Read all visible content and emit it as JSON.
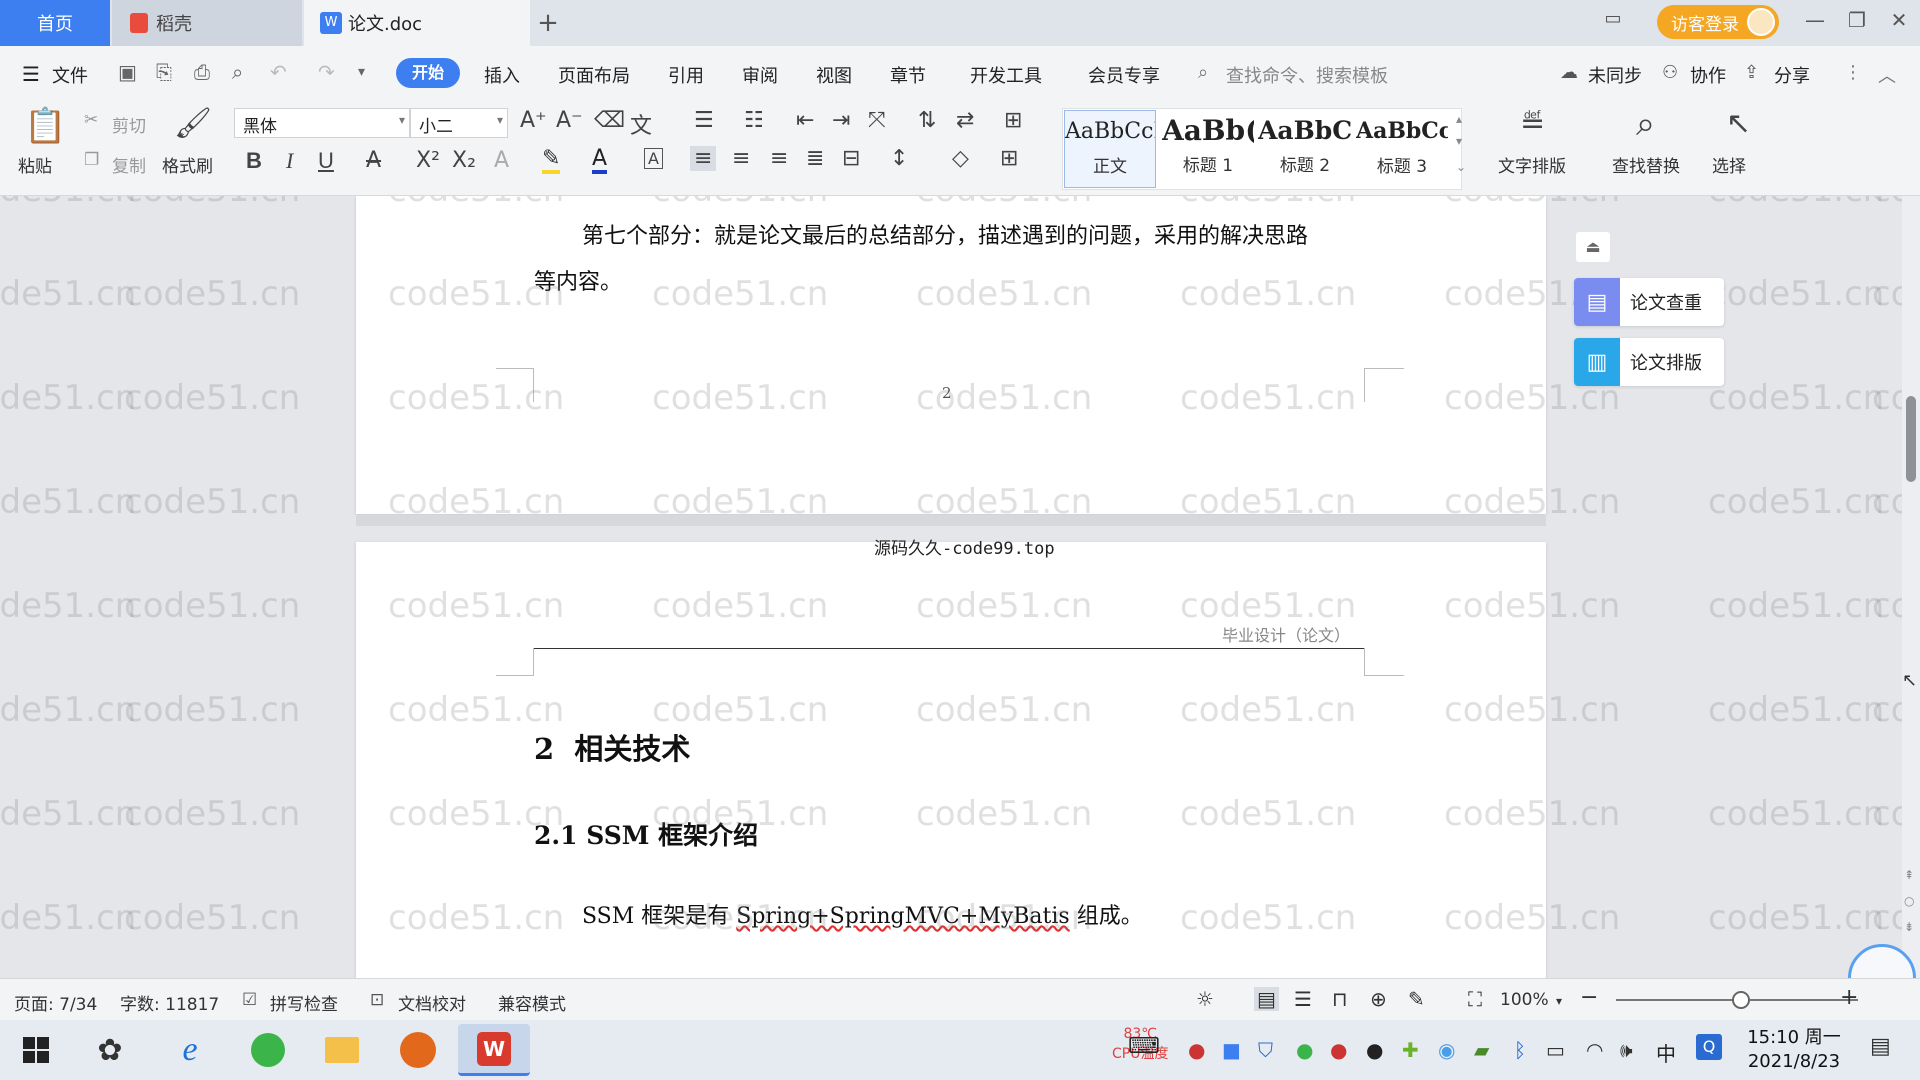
{
  "tabs": {
    "home": "首页",
    "daoke": "稻壳",
    "doc": "论文.doc",
    "add": "+"
  },
  "login": {
    "label": "访客登录"
  },
  "menu": {
    "file": "文件",
    "items": [
      "开始",
      "插入",
      "页面布局",
      "引用",
      "审阅",
      "视图",
      "章节",
      "开发工具",
      "会员专享"
    ],
    "search_placeholder": "查找命令、搜索模板",
    "sync": "未同步",
    "collab": "协作",
    "share": "分享"
  },
  "ribbon": {
    "paste": "粘贴",
    "cut": "剪切",
    "copy": "复制",
    "format_painter": "格式刷",
    "font_name": "黑体",
    "font_size": "小二",
    "bold": "B",
    "italic": "I",
    "underline": "U",
    "styles": [
      {
        "sample": "AaBbCcI",
        "name": "正文"
      },
      {
        "sample": "AaBb(",
        "name": "标题 1"
      },
      {
        "sample": "AaBbC",
        "name": "标题 2"
      },
      {
        "sample": "AaBbCcl",
        "name": "标题 3"
      }
    ],
    "text_layout": "文字排版",
    "find_replace": "查找替换",
    "select": "选择"
  },
  "document": {
    "page1_paragraph_line1": "第七个部分：就是论文最后的总结部分，描述遇到的问题，采用的解决思路",
    "page1_paragraph_line2": "等内容。",
    "page1_number": "2",
    "between_pages_text": "源码久久-code99.top",
    "page2_header": "毕业设计（论文）",
    "heading_2": "2  相关技术",
    "heading_2_1": "2.1 SSM 框架介绍",
    "body_prefix": "SSM 框架是有 ",
    "body_spring": "Spring+SpringMVC+MyBatis",
    "body_suffix": " 组成。"
  },
  "watermark": "code51.cn",
  "side_panel": {
    "check": "论文查重",
    "layout": "论文排版"
  },
  "status": {
    "page": "页面: 7/34",
    "words": "字数: 11817",
    "spell": "拼写检查",
    "proof": "文档校对",
    "compat": "兼容模式",
    "zoom": "100%",
    "zoom_level": 1.0
  },
  "taskbar": {
    "time": "15:10 周一",
    "date": "2021/8/23",
    "ime": "中",
    "cpu_temp": "83℃",
    "cpu_label": "CPU温度"
  },
  "colors": {
    "accent": "#3d7ff0",
    "login": "#f5a623",
    "side_check": "#7b8cf0",
    "side_layout": "#29a7e8"
  }
}
